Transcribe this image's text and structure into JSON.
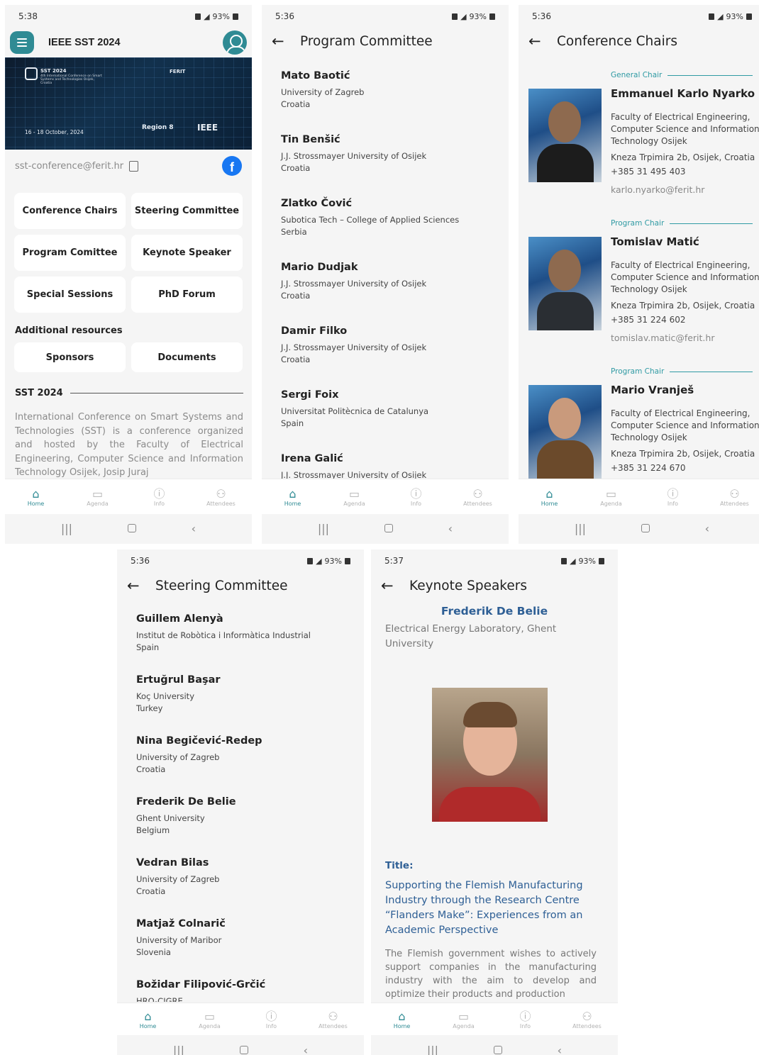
{
  "home": {
    "status_time": "5:38",
    "battery": "93%",
    "app_title": "IEEE SST 2024",
    "banner": {
      "title": "SST 2024",
      "subtitle": "4th International Conference on Smart Systems and Technologies Osijek, Croatia",
      "date": "16 - 18 October, 2024",
      "ferit": "FERIT",
      "region": "Region 8",
      "ieee": "IEEE"
    },
    "email": "sst-conference@ferit.hr",
    "buttons": [
      "Conference Chairs",
      "Steering Committee",
      "Program Comittee",
      "Keynote Speaker",
      "Special Sessions",
      "PhD Forum"
    ],
    "additional_heading": "Additional resources",
    "additional_buttons": [
      "Sponsors",
      "Documents"
    ],
    "section_title": "SST 2024",
    "description": "International Conference on Smart Systems and Technologies (SST) is a conference organized and hosted by the Faculty of Electrical Engineering, Computer Science and Information Technology Osijek, Josip Juraj"
  },
  "nav": {
    "home": "Home",
    "agenda": "Agenda",
    "info": "Info",
    "attendees": "Attendees"
  },
  "program": {
    "status_time": "5:36",
    "battery": "93%",
    "title": "Program Committee",
    "members": [
      {
        "name": "Mato Baotić",
        "aff1": "University of Zagreb",
        "aff2": "Croatia"
      },
      {
        "name": "Tin Benšić",
        "aff1": "J.J. Strossmayer University of Osijek",
        "aff2": "Croatia"
      },
      {
        "name": "Zlatko Čović",
        "aff1": "Subotica Tech – College of Applied Sciences",
        "aff2": "Serbia"
      },
      {
        "name": "Mario Dudjak",
        "aff1": "J.J. Strossmayer University of Osijek",
        "aff2": "Croatia"
      },
      {
        "name": "Damir Filko",
        "aff1": "J.J. Strossmayer University of Osijek",
        "aff2": "Croatia"
      },
      {
        "name": "Sergi Foix",
        "aff1": "Universitat Politècnica de Catalunya",
        "aff2": "Spain"
      },
      {
        "name": "Irena Galić",
        "aff1": "J.J. Strossmayer University of Osijek",
        "aff2": ""
      }
    ]
  },
  "chairs": {
    "status_time": "5:36",
    "battery": "93%",
    "title": "Conference Chairs",
    "items": [
      {
        "role": "General Chair",
        "name": "Emmanuel Karlo Nyarko",
        "faculty": "Faculty of Electrical Engineering, Computer Science and Information Technology Osijek",
        "address": "Kneza Trpimira 2b, Osijek, Croatia",
        "phone": "+385 31 495 403",
        "email": "karlo.nyarko@ferit.hr"
      },
      {
        "role": "Program Chair",
        "name": "Tomislav Matić",
        "faculty": "Faculty of Electrical Engineering, Computer Science and Information Technology Osijek",
        "address": "Kneza Trpimira 2b, Osijek, Croatia",
        "phone": "+385 31 224 602",
        "email": "tomislav.matic@ferit.hr"
      },
      {
        "role": "Program Chair",
        "name": "Mario Vranješ",
        "faculty": "Faculty of Electrical Engineering, Computer Science and Information Technology Osijek",
        "address": "Kneza Trpimira 2b, Osijek, Croatia",
        "phone": "+385 31 224 670",
        "email": ""
      }
    ]
  },
  "steering": {
    "status_time": "5:36",
    "battery": "93%",
    "title": "Steering Committee",
    "members": [
      {
        "name": "Guillem Alenyà",
        "aff1": "Institut de Robòtica i Informàtica Industrial",
        "aff2": "Spain"
      },
      {
        "name": "Ertuğrul Başar",
        "aff1": "Koç University",
        "aff2": "Turkey"
      },
      {
        "name": "Nina Begičević-Redep",
        "aff1": "University of Zagreb",
        "aff2": "Croatia"
      },
      {
        "name": "Frederik De Belie",
        "aff1": "Ghent University",
        "aff2": "Belgium"
      },
      {
        "name": "Vedran Bilas",
        "aff1": "University of Zagreb",
        "aff2": "Croatia"
      },
      {
        "name": "Matjaž Colnarič",
        "aff1": "University of Maribor",
        "aff2": "Slovenia"
      },
      {
        "name": "Božidar Filipović-Grčić",
        "aff1": "HRO-CIGRE",
        "aff2": ""
      }
    ]
  },
  "keynote": {
    "status_time": "5:37",
    "battery": "93%",
    "title": "Keynote Speakers",
    "speaker": "Frederik De Belie",
    "affiliation": "Electrical Energy Laboratory, Ghent University",
    "title_label": "Title:",
    "talk_title": "Supporting the Flemish Manufacturing Industry through the Research Centre “Flanders Make”: Experiences from an Academic Perspective",
    "description": "The Flemish government wishes to actively support companies in the manufacturing industry with the aim to develop and optimize their products and production"
  }
}
